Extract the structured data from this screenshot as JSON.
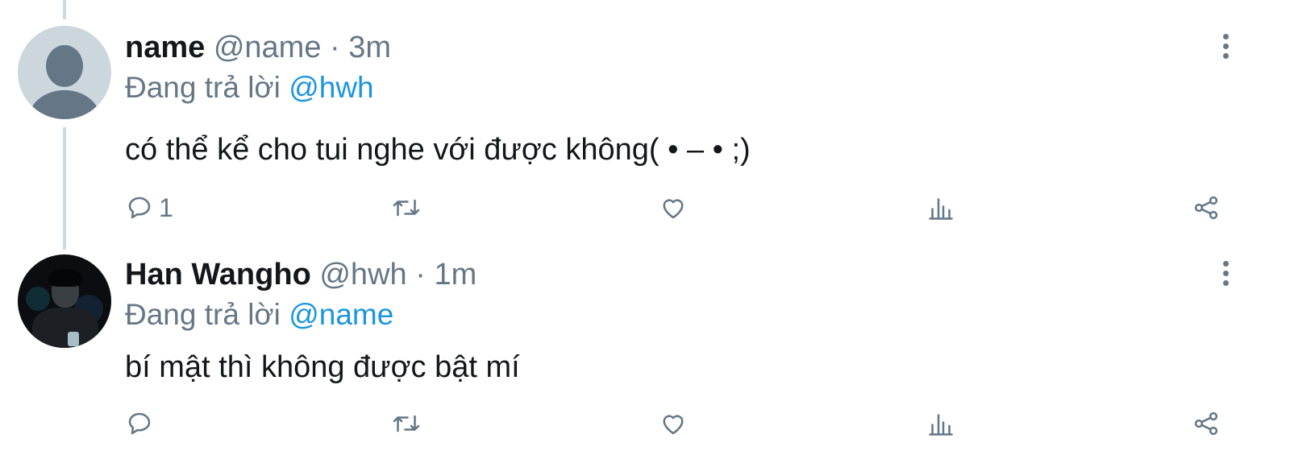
{
  "tweets": [
    {
      "display_name": "name",
      "handle": "@name",
      "separator": "·",
      "time": "3m",
      "reply_prefix": "Đang trả lời",
      "reply_to": "@hwh",
      "text": "có thể kể cho tui nghe với được không( • – • ;)",
      "reply_count": "1",
      "avatar": "default-avatar-icon"
    },
    {
      "display_name": "Han Wangho",
      "handle": "@hwh",
      "separator": "·",
      "time": "1m",
      "reply_prefix": "Đang trả lời",
      "reply_to": "@name",
      "text": "bí mật thì không được bật mí",
      "reply_count": "",
      "avatar": "profile-photo"
    }
  ],
  "icons": {
    "reply": "comment-icon",
    "retweet": "retweet-icon",
    "like": "heart-icon",
    "stats": "analytics-icon",
    "share": "share-icon",
    "more": "more-vertical-icon"
  },
  "colors": {
    "text": "#14171a",
    "secondary": "#657786",
    "link": "#1b95e0",
    "thread_line": "#cfd9de"
  }
}
